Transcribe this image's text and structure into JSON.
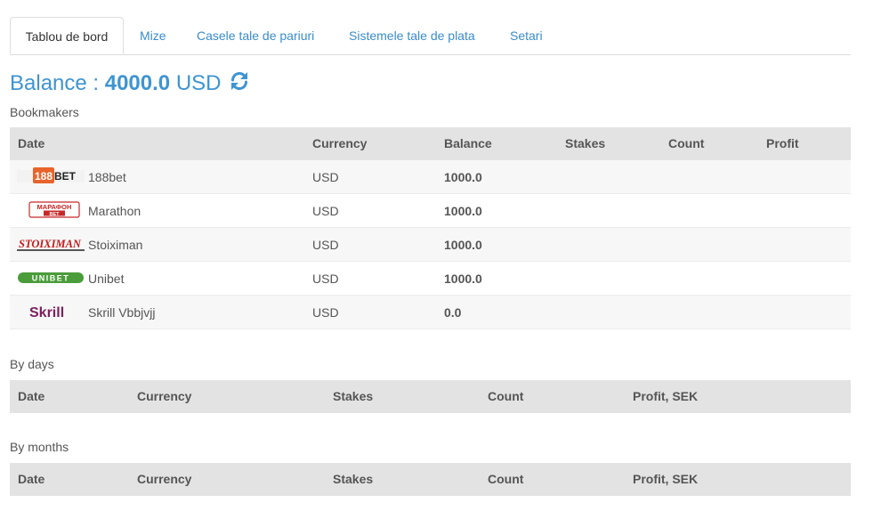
{
  "tabs": [
    {
      "label": "Tablou de bord",
      "active": true
    },
    {
      "label": "Mize"
    },
    {
      "label": "Casele tale de pariuri"
    },
    {
      "label": "Sistemele tale de plata"
    },
    {
      "label": "Setari"
    }
  ],
  "balance": {
    "prefix": "Balance : ",
    "amount": "4000.0",
    "currency": "USD"
  },
  "bookmakers": {
    "label": "Bookmakers",
    "columns": [
      "Date",
      "Currency",
      "Balance",
      "Stakes",
      "Count",
      "Profit"
    ],
    "rows": [
      {
        "name": "188bet",
        "logo": "188bet-logo",
        "currency": "USD",
        "balance": "1000.0"
      },
      {
        "name": "Marathon",
        "logo": "marathon-logo",
        "currency": "USD",
        "balance": "1000.0"
      },
      {
        "name": "Stoiximan",
        "logo": "stoiximan-logo",
        "currency": "USD",
        "balance": "1000.0"
      },
      {
        "name": "Unibet",
        "logo": "unibet-logo",
        "currency": "USD",
        "balance": "1000.0"
      },
      {
        "name": "Skrill Vbbjvjj",
        "logo": "skrill-logo",
        "currency": "USD",
        "balance": "0.0"
      }
    ]
  },
  "by_days": {
    "label": "By days",
    "columns": [
      "Date",
      "Currency",
      "Stakes",
      "Count",
      "Profit, SEK"
    ]
  },
  "by_months": {
    "label": "By months",
    "columns": [
      "Date",
      "Currency",
      "Stakes",
      "Count",
      "Profit, SEK"
    ]
  },
  "logo_text": {
    "b188": [
      "188",
      "BET"
    ],
    "marathon": [
      "МАРАФОН",
      "BET"
    ],
    "stoiximan": "STOIXIMAN",
    "unibet": "UNIBET",
    "skrill": "Skrill"
  },
  "colors": {
    "accent": "#3e94d1",
    "link": "#3a8cc9",
    "header_bg": "#e3e3e3"
  }
}
